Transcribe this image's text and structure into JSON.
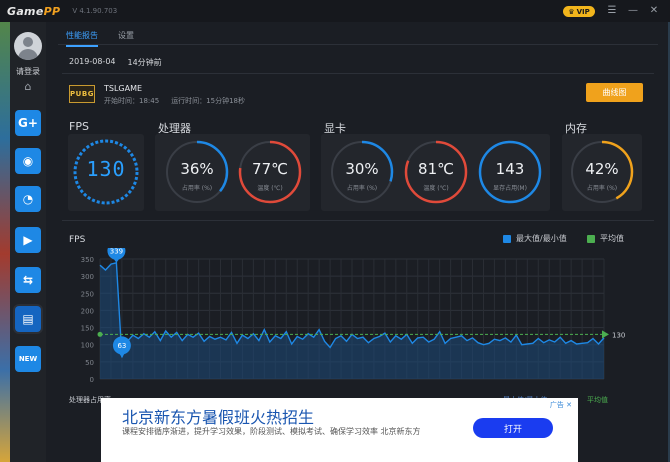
{
  "window": {
    "app_name_a": "Game",
    "app_name_b": "PP",
    "version": "V 4.1.90.703",
    "vip_label": "VIP",
    "menu_icon": "menu-icon",
    "minimize_icon": "minimize-icon",
    "close_icon": "close-icon"
  },
  "sidebar": {
    "login_label": "请登录",
    "items": [
      {
        "icon": "g-plus-icon",
        "glyph": "G+"
      },
      {
        "icon": "eye-icon",
        "glyph": "◉"
      },
      {
        "icon": "speedometer-icon",
        "glyph": "◔"
      },
      {
        "icon": "video-icon",
        "glyph": "▶"
      },
      {
        "icon": "boost-icon",
        "glyph": "⇆"
      },
      {
        "icon": "report-icon",
        "glyph": "▤"
      },
      {
        "icon": "news-icon",
        "glyph": "NEW"
      }
    ]
  },
  "tabs": [
    {
      "label": "性能报告",
      "active": true
    },
    {
      "label": "设置",
      "active": false
    }
  ],
  "session": {
    "date": "2019-08-04",
    "duration": "14分钟前"
  },
  "game": {
    "logo_text": "PUBG",
    "name": "TSLGAME",
    "start_time": "开始时间：18:45",
    "run_time": "运行时间：15分钟18秒",
    "chart_button": "曲线图"
  },
  "stats": {
    "fps": {
      "title": "FPS",
      "value": "130",
      "color": "#1e88e5"
    },
    "cpu": {
      "title": "处理器",
      "usage": {
        "value": "36%",
        "label": "占用率 (%)",
        "fraction": 0.36,
        "color": "#1e88e5"
      },
      "temp": {
        "value": "77℃",
        "label": "温度 (℃)",
        "fraction": 0.77,
        "color": "#e04a3a"
      }
    },
    "gpu": {
      "title": "显卡",
      "usage": {
        "value": "30%",
        "label": "占用率 (%)",
        "fraction": 0.3,
        "color": "#1e88e5"
      },
      "temp": {
        "value": "81℃",
        "label": "温度 (℃)",
        "fraction": 0.81,
        "color": "#e04a3a"
      },
      "vram": {
        "value": "143",
        "label": "显存占用(M)",
        "fraction": 1.0,
        "color": "#1e88e5"
      }
    },
    "memory": {
      "title": "内存",
      "usage": {
        "value": "42%",
        "label": "占用率 (%)",
        "fraction": 0.42,
        "color": "#f0a21c"
      }
    }
  },
  "chart_data": {
    "type": "area",
    "title": "FPS",
    "legend": [
      {
        "name": "最大值/最小值",
        "color": "#1e88e5"
      },
      {
        "name": "平均值",
        "color": "#4caf50"
      }
    ],
    "ylim": [
      0,
      350
    ],
    "yticks": [
      "350",
      "300",
      "250",
      "200",
      "150",
      "100",
      "50",
      "0"
    ],
    "max_label": "339",
    "min_label": "63",
    "avg_label": "130.09",
    "average": 130.09,
    "values": [
      332,
      318,
      335,
      339,
      63,
      110,
      128,
      118,
      132,
      122,
      138,
      112,
      140,
      122,
      136,
      112,
      130,
      122,
      134,
      110,
      124,
      116,
      122,
      114,
      136,
      104,
      128,
      118,
      132,
      112,
      144,
      108,
      126,
      118,
      138,
      102,
      124,
      116,
      132,
      122,
      144,
      110,
      92,
      118,
      126,
      110,
      130,
      118,
      122,
      106,
      118,
      124,
      134,
      108,
      126,
      116,
      130,
      104,
      120,
      122,
      108,
      116,
      138,
      104,
      118,
      122,
      126,
      112,
      120,
      106,
      100,
      104,
      116,
      112,
      120,
      108,
      128,
      100,
      102,
      104,
      118,
      106,
      114,
      108,
      122,
      104,
      112,
      102,
      104,
      106,
      118,
      102,
      120
    ]
  },
  "ad": {
    "tag": "广告 ✕",
    "title": "北京新东方暑假班火热招生",
    "desc": "课程安排循序渐进，提升学习效果，阶段测试、模拟考试、确保学习效率 北京新东方",
    "button": "打开"
  },
  "bottom_legend": {
    "a": "最大值/最小值",
    "b": "平均值",
    "title": "处理器占用率"
  }
}
